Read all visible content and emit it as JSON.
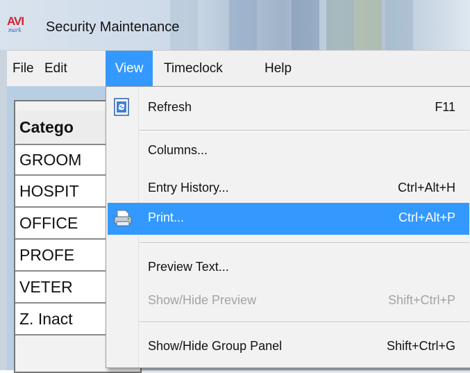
{
  "window": {
    "title": "Security Maintenance",
    "logo_top": "AVI",
    "logo_bottom": "mark"
  },
  "menubar": {
    "items": [
      {
        "label": "File"
      },
      {
        "label": "Edit"
      },
      {
        "label": "View",
        "active": true
      },
      {
        "label": "Timeclock"
      },
      {
        "label": "Help"
      }
    ]
  },
  "grid": {
    "header": "Catego",
    "rows": [
      "GROOM",
      "HOSPIT",
      "OFFICE",
      "PROFE",
      "VETER",
      "Z. Inact"
    ]
  },
  "view_menu": {
    "items": [
      {
        "label": "Refresh",
        "shortcut": "F11",
        "icon": "refresh-icon"
      },
      {
        "label": "Columns..."
      },
      {
        "label": "Entry History...",
        "shortcut": "Ctrl+Alt+H"
      },
      {
        "label": "Print...",
        "shortcut": "Ctrl+Alt+P",
        "icon": "printer-icon",
        "highlighted": true
      },
      {
        "label": "Preview Text..."
      },
      {
        "label": "Show/Hide Preview",
        "shortcut": "Shift+Ctrl+P",
        "disabled": true
      },
      {
        "label": "Show/Hide Group Panel",
        "shortcut": "Shift+Ctrl+G"
      }
    ]
  },
  "colors": {
    "menu_highlight": "#3399ff",
    "window_body": "#b8cfe3"
  }
}
